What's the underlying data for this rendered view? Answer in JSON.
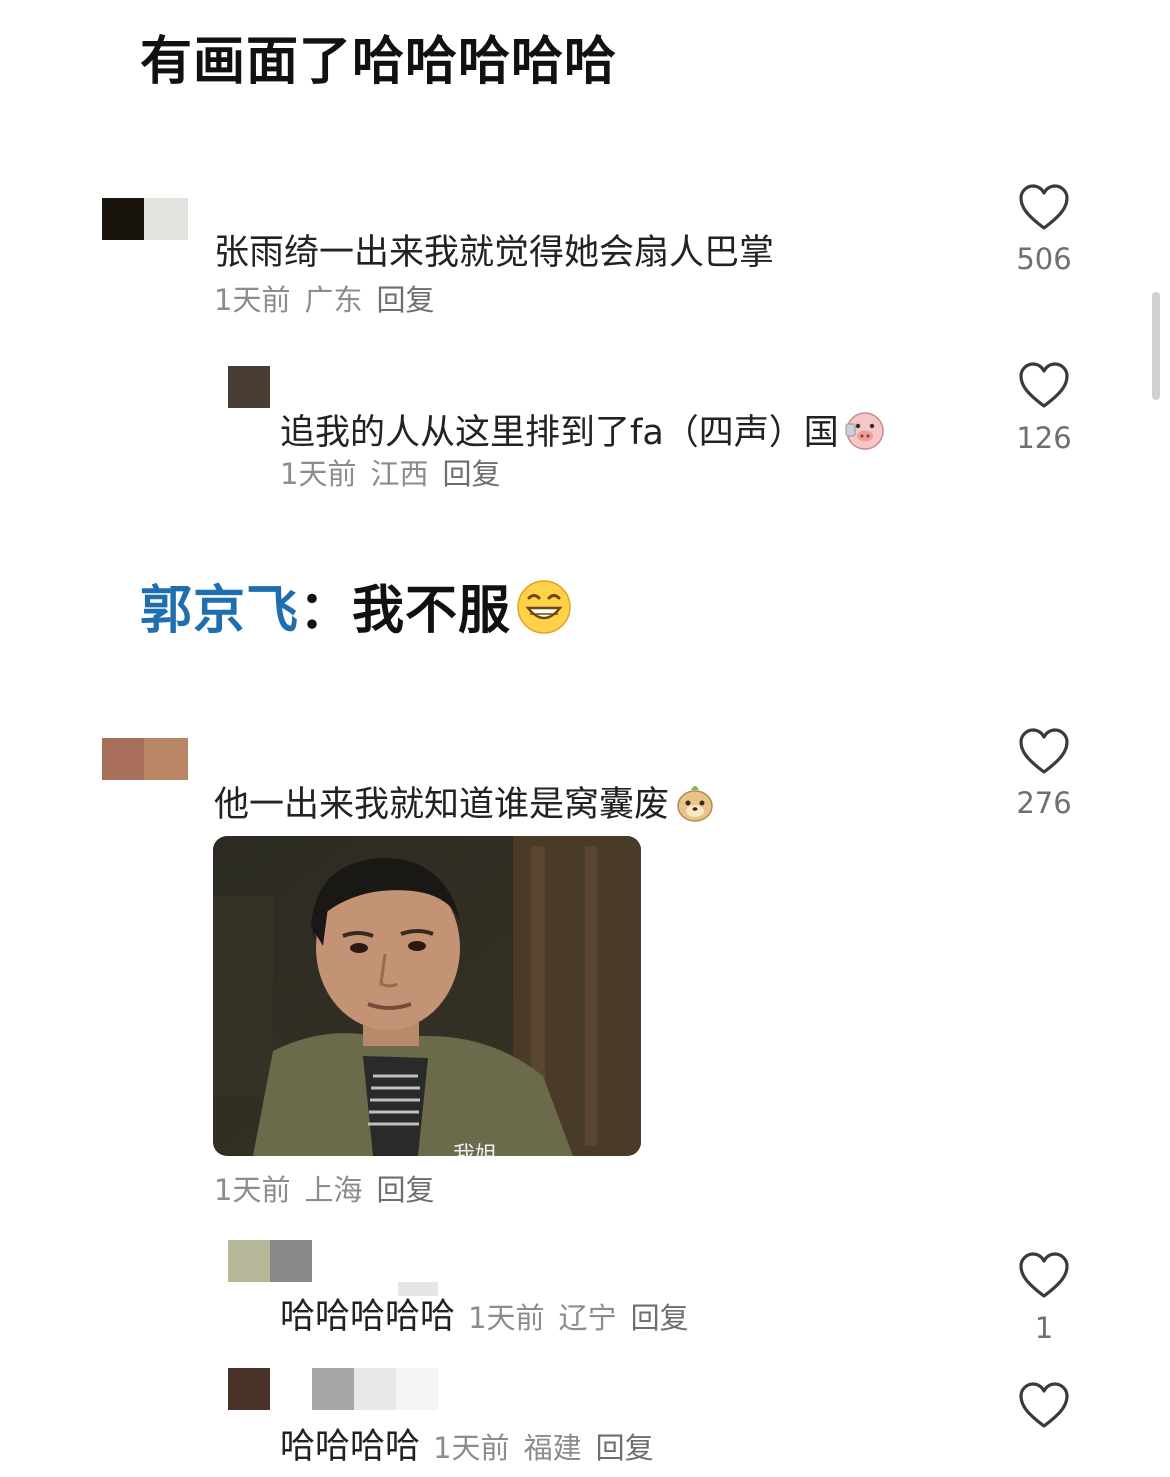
{
  "captions": {
    "top": "有画面了哈哈哈哈哈",
    "mid_speaker": "郭京飞",
    "mid_sep": "：",
    "mid_text": "我不服"
  },
  "comments": [
    {
      "text": "张雨绮一出来我就觉得她会扇人巴掌",
      "time": "1天前",
      "location": "广东",
      "reply": "回复",
      "likes": "506"
    },
    {
      "text": "追我的人从这里排到了fa（四声）国",
      "time": "1天前",
      "location": "江西",
      "reply": "回复",
      "likes": "126"
    },
    {
      "text": "他一出来我就知道谁是窝囊废",
      "time": "1天前",
      "location": "上海",
      "reply": "回复",
      "likes": "276",
      "image_subtitle": "我姐"
    },
    {
      "text": "哈哈哈哈哈",
      "time": "1天前",
      "location": "辽宁",
      "reply": "回复",
      "likes": "1"
    },
    {
      "text": "哈哈哈哈",
      "time": "1天前",
      "location": "福建",
      "reply": "回复",
      "likes": ""
    }
  ],
  "icons": {
    "like": "heart-outline-icon",
    "emoji_pig": "pig-face-emoji",
    "emoji_grin": "grinning-face-emoji",
    "emoji_meerkat": "meerkat-emoji"
  },
  "colors": {
    "speaker": "#1f6fb0",
    "meta": "#8c8c8c",
    "text": "#222222"
  }
}
